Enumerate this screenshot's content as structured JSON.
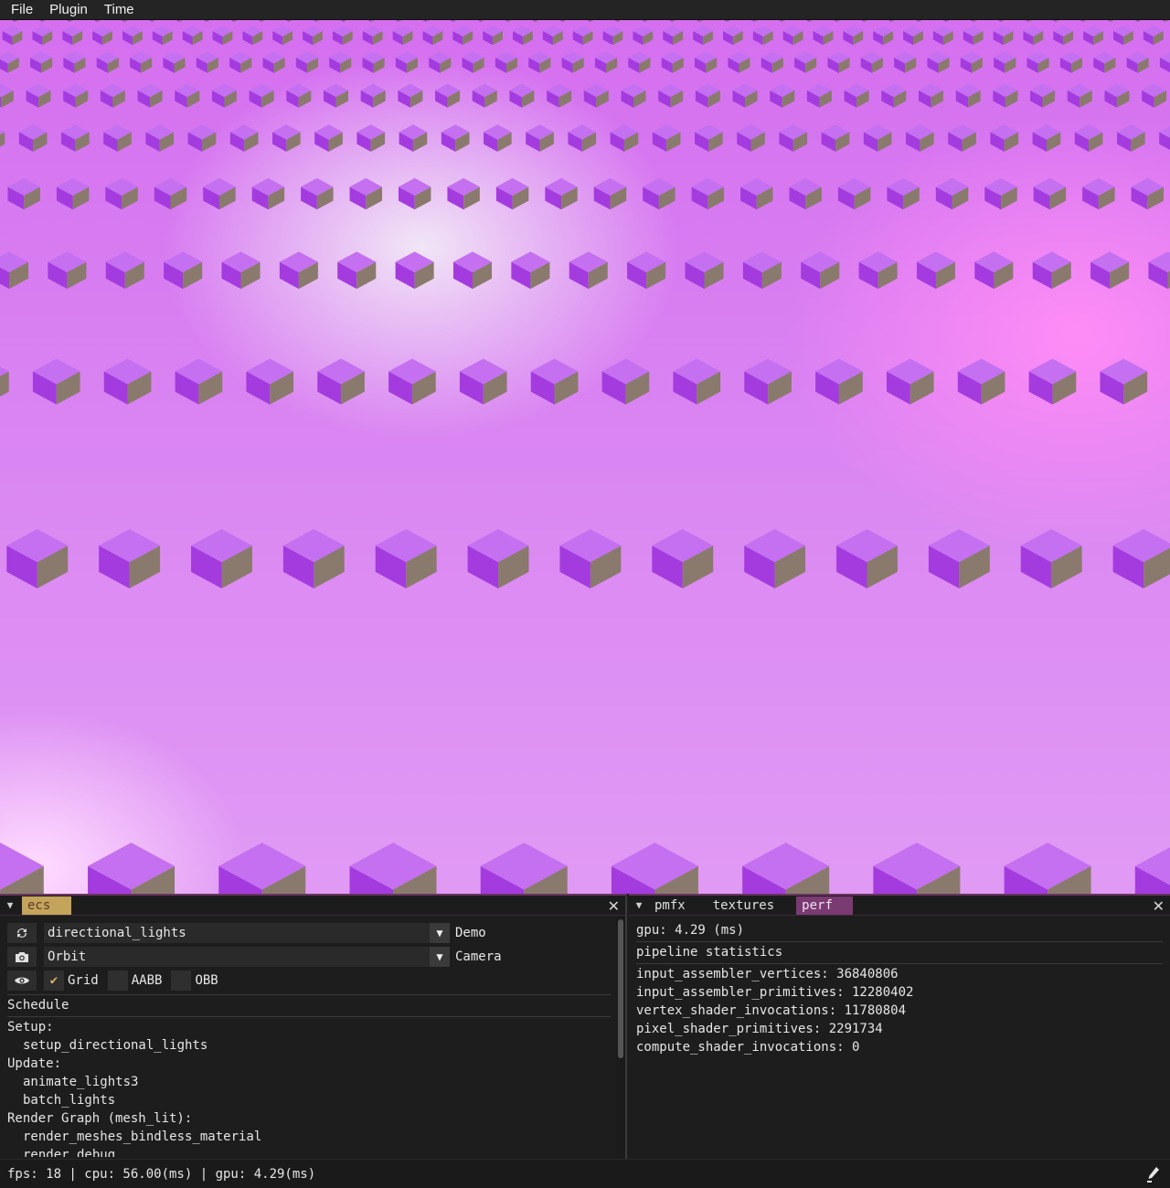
{
  "menu": {
    "items": [
      "File",
      "Plugin",
      "Time"
    ]
  },
  "viewport": {
    "scene": "directional_lights",
    "background_color": "#d98ef5",
    "cube_color": "#b344e6"
  },
  "ecs_panel": {
    "tab": "ecs",
    "demo": {
      "value": "directional_lights",
      "label": "Demo",
      "icon": "refresh-icon"
    },
    "camera": {
      "value": "Orbit",
      "label": "Camera",
      "icon": "camera-icon"
    },
    "visibility": {
      "icon": "eye-icon",
      "checkboxes": [
        {
          "label": "Grid",
          "checked": true
        },
        {
          "label": "AABB",
          "checked": false
        },
        {
          "label": "OBB",
          "checked": false
        }
      ]
    },
    "schedule_header": "Schedule",
    "schedule": [
      {
        "text": "Setup:",
        "indent": 0
      },
      {
        "text": "setup_directional_lights",
        "indent": 1
      },
      {
        "text": "Update:",
        "indent": 0
      },
      {
        "text": "animate_lights3",
        "indent": 1
      },
      {
        "text": "batch_lights",
        "indent": 1
      },
      {
        "text": "Render Graph (mesh_lit):",
        "indent": 0
      },
      {
        "text": "render_meshes_bindless_material",
        "indent": 1
      },
      {
        "text": "render_debug",
        "indent": 1
      }
    ]
  },
  "perf_panel": {
    "tabs": [
      "pmfx",
      "textures",
      "perf"
    ],
    "active_tab": "perf",
    "gpu": "gpu: 4.29 (ms)",
    "pipeline_header": "pipeline statistics",
    "stats": [
      "input_assembler_vertices: 36840806",
      "input_assembler_primitives: 12280402",
      "vertex_shader_invocations: 11780804",
      "pixel_shader_primitives: 2291734",
      "compute_shader_invocations: 0"
    ]
  },
  "status": {
    "text": "fps: 18 | cpu: 56.00(ms) | gpu: 4.29(ms)",
    "icon": "pencil-icon"
  }
}
